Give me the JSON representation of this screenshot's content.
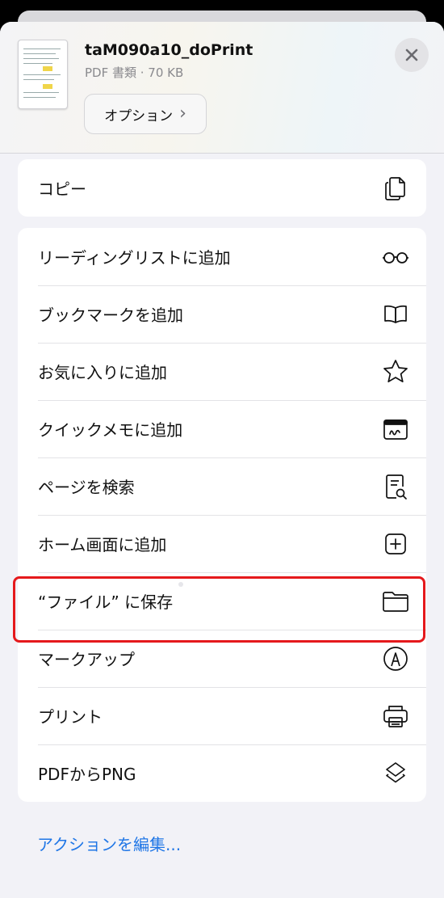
{
  "document": {
    "title": "taM090a10_doPrint",
    "subtitle": "PDF 書類 · 70 KB"
  },
  "options_button": {
    "label": "オプション",
    "chevron": "›"
  },
  "close_button": {
    "icon": "close-icon"
  },
  "groups": [
    {
      "items": [
        {
          "label": "コピー",
          "icon": "copy-icon"
        }
      ]
    },
    {
      "items": [
        {
          "label": "リーディングリストに追加",
          "icon": "glasses-icon"
        },
        {
          "label": "ブックマークを追加",
          "icon": "book-icon"
        },
        {
          "label": "お気に入りに追加",
          "icon": "star-icon"
        },
        {
          "label": "クイックメモに追加",
          "icon": "quick-note-icon"
        },
        {
          "label": "ページを検索",
          "icon": "find-in-page-icon"
        },
        {
          "label": "ホーム画面に追加",
          "icon": "add-square-icon"
        },
        {
          "label": "“ファイル” に保存",
          "icon": "folder-icon"
        },
        {
          "label": "マークアップ",
          "icon": "markup-icon"
        },
        {
          "label": "プリント",
          "icon": "printer-icon"
        },
        {
          "label": "PDFからPNG",
          "icon": "shortcuts-icon"
        }
      ]
    }
  ],
  "edit_actions": "アクションを編集...",
  "colors": {
    "highlight": "#e5191c",
    "link": "#1f76e6"
  }
}
